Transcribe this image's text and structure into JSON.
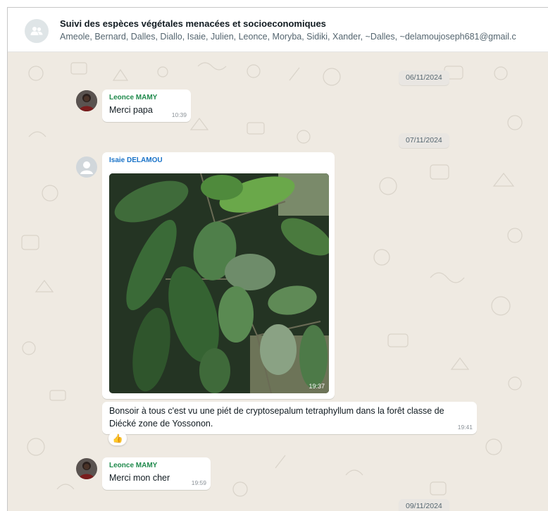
{
  "header": {
    "title": "Suivi des espèces végétales menacées et socioeconomiques",
    "members": "Ameole, Bernard, Dalles, Diallo, Isaie, Julien, Leonce, Moryba, Sidiki, Xander, ~Dalles, ~delamoujoseph681@gmail.c"
  },
  "messages": {
    "date1": "06/11/2024",
    "m1": {
      "sender": "Leonce MAMY",
      "text": "Merci papa",
      "time": "10:39"
    },
    "date2": "07/11/2024",
    "m2": {
      "sender": "Isaie DELAMOU",
      "image_time": "19:37"
    },
    "m3": {
      "text_line1": "Bonsoir à tous c'est vu une piét de cryptosepalum tetraphyllum dans la forêt classe de",
      "text_line2": "Diécké zone de Yossonon.",
      "time": "19:41",
      "reaction": "👍"
    },
    "m4": {
      "sender": "Leonce MAMY",
      "text": "Merci mon cher",
      "time": "19:59"
    },
    "date3": "09/11/2024"
  },
  "colors": {
    "sender_leonce": "#1f8a4c",
    "sender_isaie": "#1a73c8",
    "chat_bg": "#efeae2"
  },
  "icons": {
    "group_avatar": "group-people-icon",
    "default_avatar": "person-icon"
  }
}
